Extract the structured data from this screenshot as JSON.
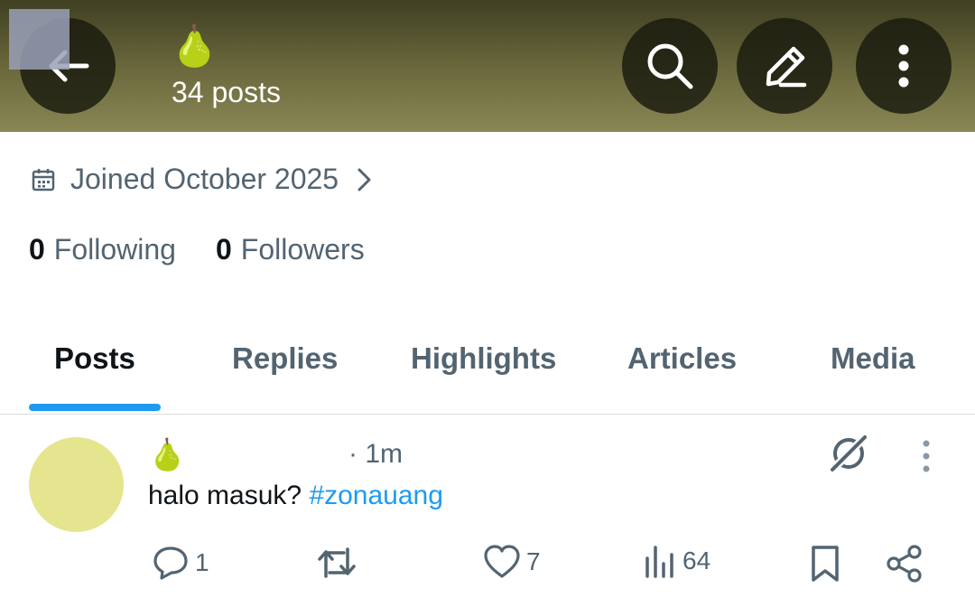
{
  "header": {
    "profile_emoji": "🍐",
    "post_count": "34 posts"
  },
  "profile": {
    "joined": "Joined October 2025",
    "following_count": "0",
    "following_label": "Following",
    "followers_count": "0",
    "followers_label": "Followers"
  },
  "tabs": [
    {
      "label": "Posts",
      "active": true
    },
    {
      "label": "Replies"
    },
    {
      "label": "Highlights"
    },
    {
      "label": "Articles"
    },
    {
      "label": "Media"
    }
  ],
  "post": {
    "author_emoji": "🍐",
    "time": "· 1m",
    "text": "halo masuk? ",
    "hashtag": "#zonauang",
    "replies": "1",
    "likes": "7",
    "views": "64"
  },
  "colors": {
    "accent": "#1d9bf0",
    "secondary_text": "#536471",
    "avatar": "#e6e58f"
  }
}
